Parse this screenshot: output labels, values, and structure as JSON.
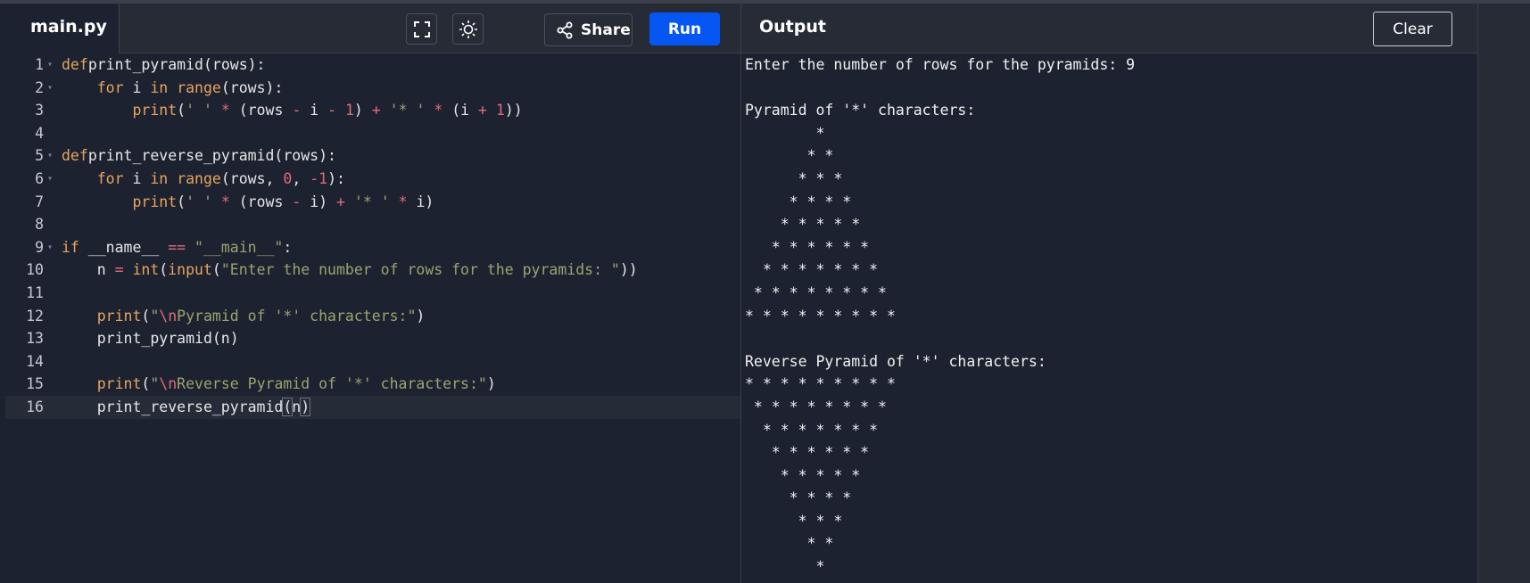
{
  "editor": {
    "file_tab": "main.py",
    "buttons": {
      "share_label": "Share",
      "run_label": "Run"
    },
    "icons": {
      "fullscreen": "fullscreen-icon",
      "theme": "sun-icon",
      "share": "share-icon"
    },
    "lines": [
      {
        "n": "1",
        "fold": true,
        "tokens": [
          [
            "kw",
            "def"
          ],
          [
            "",
            "print_pyramid(rows):"
          ]
        ]
      },
      {
        "n": "2",
        "fold": true,
        "tokens": [
          [
            "",
            "    "
          ],
          [
            "kw",
            "for"
          ],
          [
            "",
            " i "
          ],
          [
            "kw",
            "in"
          ],
          [
            "",
            " "
          ],
          [
            "kb",
            "range"
          ],
          [
            "",
            "(rows):"
          ]
        ]
      },
      {
        "n": "3",
        "fold": false,
        "tokens": [
          [
            "",
            "        "
          ],
          [
            "kb",
            "print"
          ],
          [
            "",
            "("
          ],
          [
            "str",
            "' '"
          ],
          [
            "",
            " "
          ],
          [
            "op",
            "*"
          ],
          [
            "",
            " (rows "
          ],
          [
            "op",
            "-"
          ],
          [
            "",
            " i "
          ],
          [
            "op",
            "-"
          ],
          [
            "",
            " "
          ],
          [
            "num",
            "1"
          ],
          [
            "",
            ") "
          ],
          [
            "op",
            "+"
          ],
          [
            "",
            " "
          ],
          [
            "str",
            "'* '"
          ],
          [
            "",
            " "
          ],
          [
            "op",
            "*"
          ],
          [
            "",
            " (i "
          ],
          [
            "op",
            "+"
          ],
          [
            "",
            " "
          ],
          [
            "num",
            "1"
          ],
          [
            "",
            "))"
          ]
        ]
      },
      {
        "n": "4",
        "fold": false,
        "tokens": []
      },
      {
        "n": "5",
        "fold": true,
        "tokens": [
          [
            "kw",
            "def"
          ],
          [
            "",
            "print_reverse_pyramid(rows):"
          ]
        ]
      },
      {
        "n": "6",
        "fold": true,
        "tokens": [
          [
            "",
            "    "
          ],
          [
            "kw",
            "for"
          ],
          [
            "",
            " i "
          ],
          [
            "kw",
            "in"
          ],
          [
            "",
            " "
          ],
          [
            "kb",
            "range"
          ],
          [
            "",
            "(rows, "
          ],
          [
            "num",
            "0"
          ],
          [
            "",
            ", "
          ],
          [
            "num",
            "-1"
          ],
          [
            "",
            "):"
          ]
        ]
      },
      {
        "n": "7",
        "fold": false,
        "tokens": [
          [
            "",
            "        "
          ],
          [
            "kb",
            "print"
          ],
          [
            "",
            "("
          ],
          [
            "str",
            "' '"
          ],
          [
            "",
            " "
          ],
          [
            "op",
            "*"
          ],
          [
            "",
            " (rows "
          ],
          [
            "op",
            "-"
          ],
          [
            "",
            " i) "
          ],
          [
            "op",
            "+"
          ],
          [
            "",
            " "
          ],
          [
            "str",
            "'* '"
          ],
          [
            "",
            " "
          ],
          [
            "op",
            "*"
          ],
          [
            "",
            " i)"
          ]
        ]
      },
      {
        "n": "8",
        "fold": false,
        "tokens": []
      },
      {
        "n": "9",
        "fold": true,
        "tokens": [
          [
            "kw",
            "if"
          ],
          [
            "",
            " __name__ "
          ],
          [
            "op",
            "=="
          ],
          [
            "",
            " "
          ],
          [
            "str",
            "\"__main__\""
          ],
          [
            "",
            ":"
          ]
        ]
      },
      {
        "n": "10",
        "fold": false,
        "tokens": [
          [
            "",
            "    n "
          ],
          [
            "op",
            "="
          ],
          [
            "",
            " "
          ],
          [
            "kb",
            "int"
          ],
          [
            "",
            "("
          ],
          [
            "kb",
            "input"
          ],
          [
            "",
            "("
          ],
          [
            "str",
            "\"Enter the number of rows for the pyramids: \""
          ],
          [
            "",
            "))"
          ]
        ]
      },
      {
        "n": "11",
        "fold": false,
        "tokens": []
      },
      {
        "n": "12",
        "fold": false,
        "tokens": [
          [
            "",
            "    "
          ],
          [
            "kb",
            "print"
          ],
          [
            "",
            "("
          ],
          [
            "str",
            "\""
          ],
          [
            "esc",
            "\\n"
          ],
          [
            "str",
            "Pyramid of '*' characters:\""
          ],
          [
            "",
            ")"
          ]
        ]
      },
      {
        "n": "13",
        "fold": false,
        "tokens": [
          [
            "",
            "    print_pyramid(n)"
          ]
        ]
      },
      {
        "n": "14",
        "fold": false,
        "tokens": []
      },
      {
        "n": "15",
        "fold": false,
        "tokens": [
          [
            "",
            "    "
          ],
          [
            "kb",
            "print"
          ],
          [
            "",
            "("
          ],
          [
            "str",
            "\""
          ],
          [
            "esc",
            "\\n"
          ],
          [
            "str",
            "Reverse Pyramid of '*' characters:\""
          ],
          [
            "",
            ")"
          ]
        ]
      },
      {
        "n": "16",
        "fold": false,
        "active": true,
        "tokens": [
          [
            "",
            "    print_reverse_pyramid"
          ],
          [
            "br",
            "("
          ],
          [
            "",
            "n"
          ],
          [
            "br",
            ")"
          ]
        ]
      }
    ]
  },
  "output": {
    "title": "Output",
    "clear_label": "Clear",
    "lines": [
      "Enter the number of rows for the pyramids: 9",
      "",
      "Pyramid of '*' characters:",
      "        * ",
      "       * * ",
      "      * * * ",
      "     * * * * ",
      "    * * * * * ",
      "   * * * * * * ",
      "  * * * * * * * ",
      " * * * * * * * * ",
      "* * * * * * * * * ",
      "",
      "Reverse Pyramid of '*' characters:",
      "* * * * * * * * * ",
      " * * * * * * * * ",
      "  * * * * * * * ",
      "   * * * * * * ",
      "    * * * * * ",
      "     * * * * ",
      "      * * * ",
      "       * * ",
      "        * "
    ]
  }
}
